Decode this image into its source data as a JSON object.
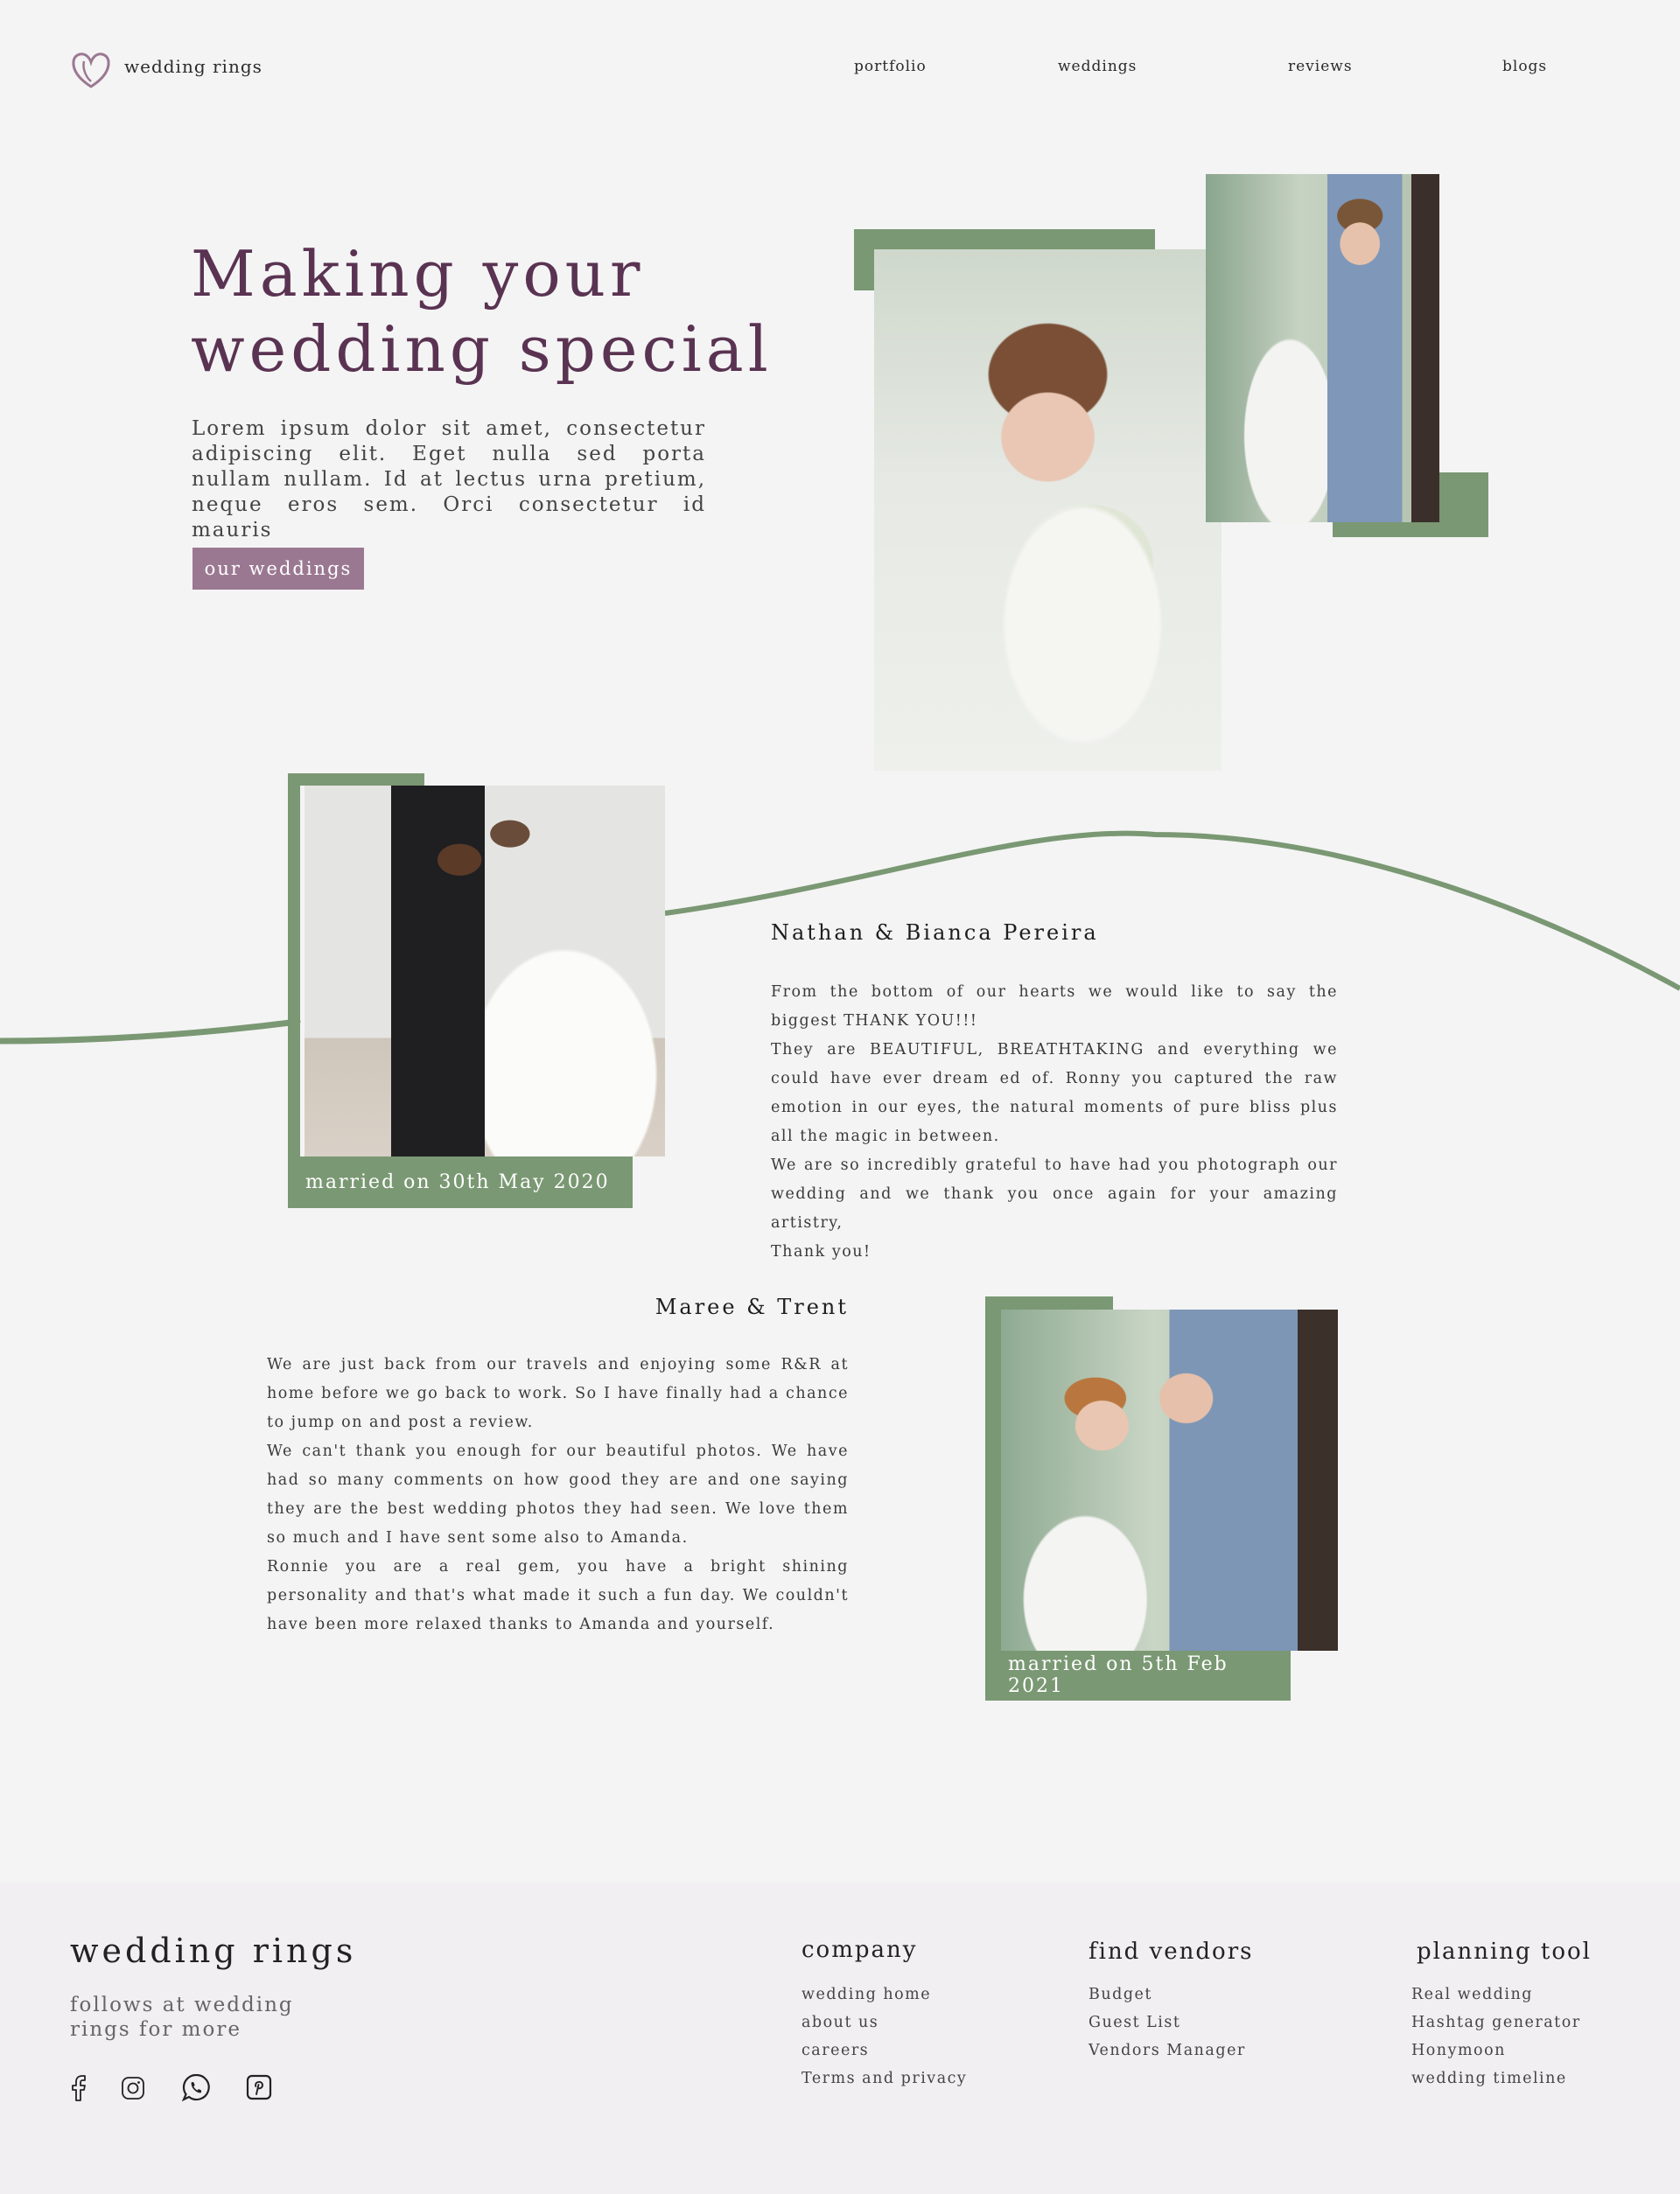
{
  "brand": {
    "name": "wedding rings"
  },
  "nav": [
    {
      "label": "portfolio"
    },
    {
      "label": "weddings"
    },
    {
      "label": "reviews"
    },
    {
      "label": "blogs"
    }
  ],
  "hero": {
    "title_line1": "Making your",
    "title_line2": "wedding special",
    "text": "Lorem ipsum dolor sit amet, consectetur adipiscing elit. Eget nulla sed porta nullam nullam. Id at lectus urna pretium, neque eros sem. Orci consectetur id mauris",
    "button_label": "our weddings"
  },
  "testimonials": [
    {
      "names": "Nathan & Bianca Pereira",
      "married": "married on 30th May 2020",
      "paragraphs": [
        "From the bottom of our hearts we would like to say the biggest THANK YOU!!!",
        "They are BEAUTIFUL, BREATHTAKING and everything we could have ever dream ed of. Ronny you captured the raw emotion in our eyes, the natural moments of pure bliss plus all the magic in between.",
        "We are so incredibly grateful to have had you photograph our wedding and we thank you once again for your amazing artistry,",
        "Thank you!"
      ]
    },
    {
      "names": "Maree & Trent",
      "married": "married on 5th Feb 2021",
      "paragraphs": [
        "We are just back from our travels and enjoying some R&R at home before we go back to work.  So I have finally had a chance to jump on and post a review.",
        "We can't thank you enough for our beautiful photos. We have had so many comments on how good they are and one saying they are the best wedding photos they had seen. We love them so much and I have sent some also to Amanda.",
        "Ronnie you are a real gem, you have a bright shining personality and that's what made it such a fun day. We couldn't have been more relaxed thanks to Amanda and yourself."
      ]
    }
  ],
  "footer": {
    "brand": "wedding rings",
    "follow": "follows at wedding rings for more",
    "social_icons": [
      "facebook-icon",
      "instagram-icon",
      "whatsapp-icon",
      "pinterest-icon"
    ],
    "columns": [
      {
        "heading": "company",
        "items": [
          "wedding home",
          "about us",
          "careers",
          "Terms and privacy"
        ]
      },
      {
        "heading": "find vendors",
        "items": [
          "Budget",
          "Guest List",
          "Vendors Manager"
        ]
      },
      {
        "heading": "planning tool",
        "items": [
          "Real wedding",
          "Hashtag generator",
          "Honymoon",
          "wedding timeline"
        ]
      }
    ]
  },
  "colors": {
    "background": "#f4f4f4",
    "accent_green": "#7a9873",
    "accent_mauve": "#9b7892",
    "title_plum": "#5a3352",
    "footer_bg": "#f2eff2"
  }
}
